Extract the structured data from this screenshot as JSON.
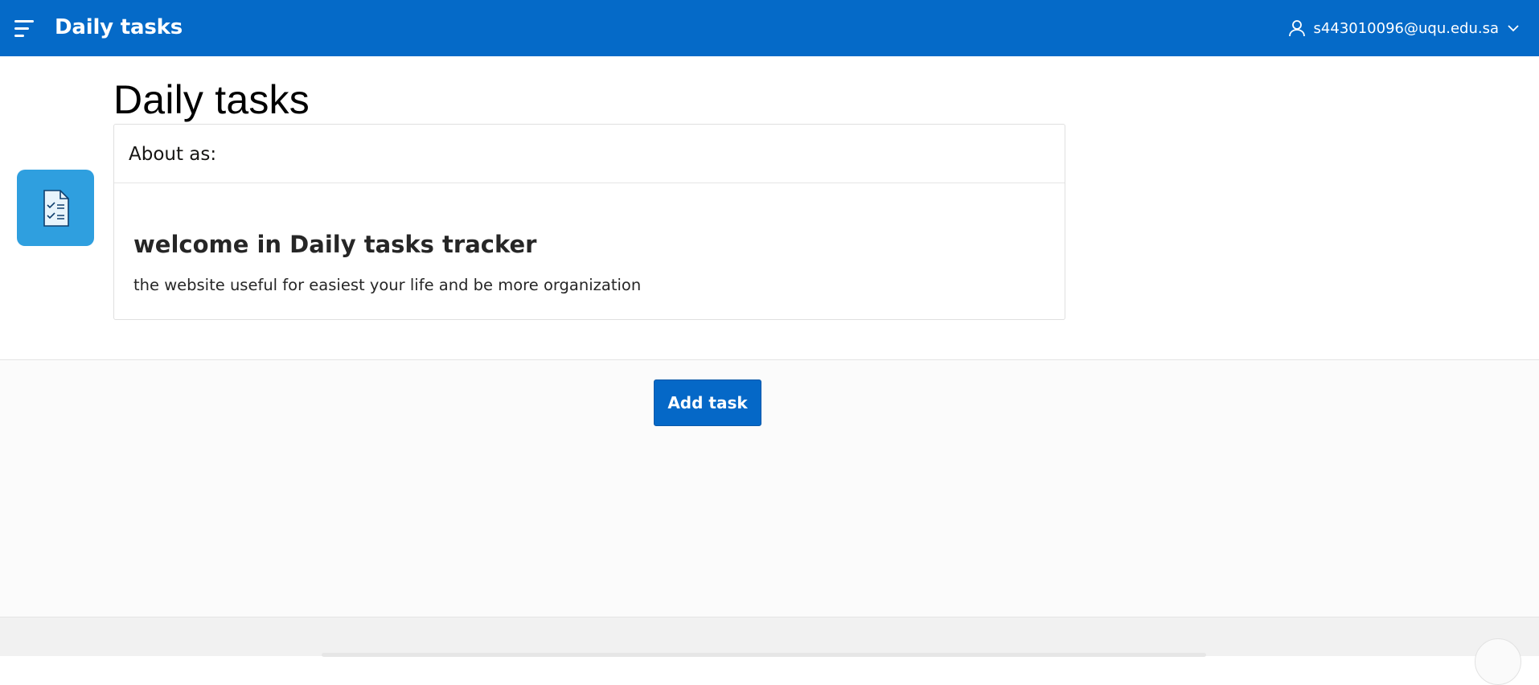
{
  "header": {
    "app_title": "Daily tasks",
    "user_email": "s443010096@uqu.edu.sa",
    "menu_icon": "hamburger-menu-icon",
    "user_icon": "user-icon",
    "dropdown_icon": "chevron-down-icon"
  },
  "page": {
    "title": "Daily tasks",
    "hero_icon": "checklist-document-icon"
  },
  "region": {
    "heading": "About as:",
    "welcome": "welcome in Daily tasks tracker",
    "description": "the website useful for easiest your life and be more organization"
  },
  "actions": {
    "add_task_label": "Add task"
  },
  "colors": {
    "header_bg": "#056ac8",
    "button_bg": "#0568c7",
    "hero_icon_bg": "#2f9fdf"
  }
}
